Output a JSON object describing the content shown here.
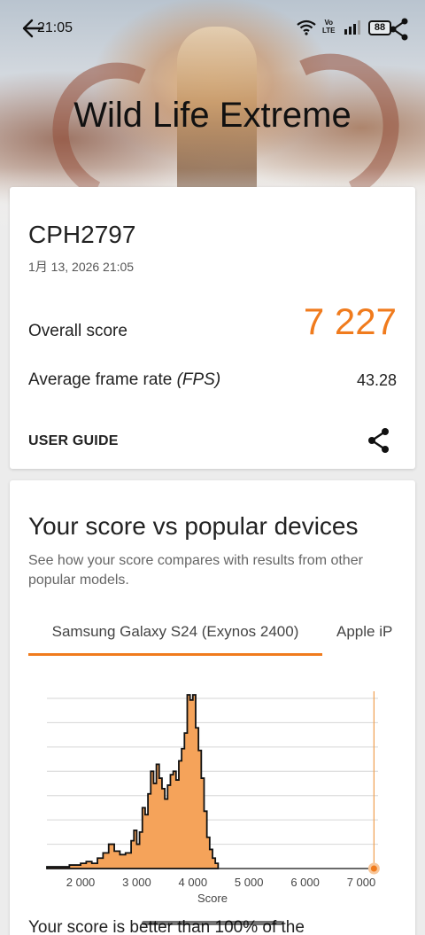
{
  "status_bar": {
    "time": "21:05",
    "volte": "Vo\nLTE",
    "battery": "88"
  },
  "header": {
    "title": "Wild Life Extreme"
  },
  "result": {
    "device": "CPH2797",
    "date": "1月 13, 2026 21:05",
    "overall_label": "Overall score",
    "overall_value": "7 227",
    "fps_label": "Average frame rate ",
    "fps_unit": "(FPS)",
    "fps_value": "43.28",
    "user_guide": "USER GUIDE"
  },
  "comparison": {
    "title": "Your score vs popular devices",
    "subtitle": "See how your score compares with results from other popular models.",
    "tabs": [
      "Samsung Galaxy S24 (Exynos 2400)",
      "Apple iP"
    ],
    "bottom_text": "Your score is better than 100% of the"
  },
  "colors": {
    "accent": "#f07b1d",
    "histogram_fill": "#f5a35a"
  },
  "chart_data": {
    "type": "area",
    "title": "",
    "xlabel": "Score",
    "ylabel": "",
    "xlim": [
      1400,
      7300
    ],
    "ylim": [
      0,
      100
    ],
    "x_ticks": [
      2000,
      3000,
      4000,
      5000,
      6000,
      7000
    ],
    "x_tick_labels": [
      "2 000",
      "3 000",
      "4 000",
      "5 000",
      "6 000",
      "7 000"
    ],
    "series": [
      {
        "x": [
          1400,
          1600,
          1800,
          1900,
          2000,
          2100,
          2200,
          2300,
          2400,
          2500,
          2600,
          2700,
          2800,
          2900,
          2950,
          3000,
          3050,
          3100,
          3150,
          3200,
          3250,
          3300,
          3350,
          3400,
          3450,
          3500,
          3550,
          3600,
          3650,
          3700,
          3750,
          3800,
          3850,
          3900,
          3950,
          4000,
          4050,
          4100,
          4150,
          4200,
          4250,
          4300,
          4350,
          4400,
          4450
        ],
        "y": [
          1,
          1,
          2,
          2,
          3,
          4,
          3,
          6,
          9,
          14,
          10,
          8,
          9,
          16,
          22,
          14,
          21,
          35,
          31,
          43,
          56,
          49,
          60,
          52,
          46,
          40,
          48,
          54,
          56,
          51,
          62,
          69,
          78,
          100,
          97,
          100,
          81,
          68,
          52,
          33,
          18,
          11,
          6,
          3,
          0
        ]
      }
    ],
    "your_score": 7227,
    "grid": true
  }
}
